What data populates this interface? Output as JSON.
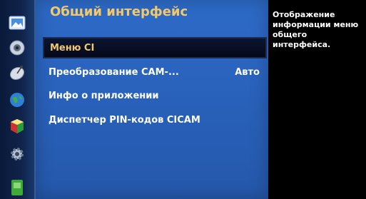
{
  "menu": {
    "title": "Общий интерфейс",
    "items": [
      {
        "label": "Меню CI",
        "value": ""
      },
      {
        "label": "Преобразование CAM-...",
        "value": "Авто"
      },
      {
        "label": "Инфо о приложении",
        "value": ""
      },
      {
        "label": "Диспетчер PIN-кодов CICAM",
        "value": ""
      }
    ],
    "selected_index": 0
  },
  "help": {
    "line1": "Отображение",
    "line2": "информации меню",
    "line3": "общего интерфейса."
  },
  "sidebar": {
    "icons": [
      "picture-icon",
      "sound-icon",
      "broadcast-icon",
      "network-icon",
      "smart-hub-icon",
      "system-icon",
      "support-icon"
    ]
  },
  "colors": {
    "panel": "#2a63bd",
    "title": "#f2c86a",
    "selected_bg": "#05091a",
    "help_bg": "#000000"
  }
}
